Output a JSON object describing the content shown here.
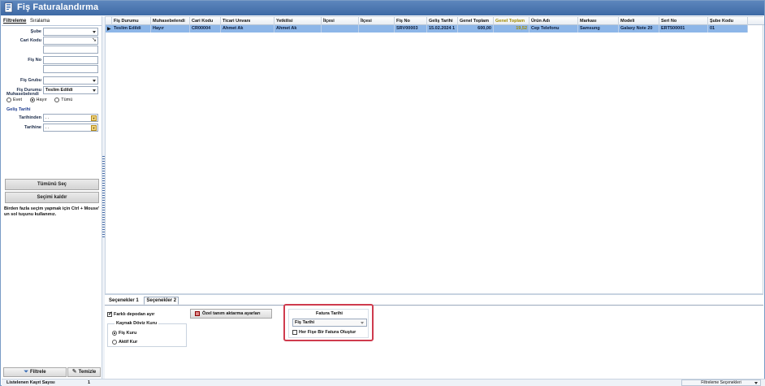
{
  "window": {
    "title": "Fiş Faturalandırma"
  },
  "left_panel": {
    "tabs": [
      {
        "label": "Filtreleme",
        "active": true
      },
      {
        "label": "Sıralama",
        "active": false
      }
    ],
    "filters": {
      "sube": {
        "label": "Şube",
        "value": ""
      },
      "cari_kodu": {
        "label": "Cari Kodu",
        "value": ""
      },
      "fis_no": {
        "label": "Fiş No",
        "value": ""
      },
      "fis_grubu": {
        "label": "Fiş Grubu",
        "value": ""
      },
      "fis_durumu": {
        "label": "Fiş Durumu",
        "value": "Teslim Edildi"
      }
    },
    "muhasebelendi": {
      "label": "Muhasebelendi",
      "options": [
        "Evet",
        "Hayır",
        "Tümü"
      ],
      "selected": "Hayır"
    },
    "gelis_tarihi": {
      "label": "Geliş Tarihi",
      "from_label": "Tarihinden",
      "from_value": " .  .",
      "to_label": "Tarihine",
      "to_value": " .  ."
    },
    "select_all_button": "Tümünü Seç",
    "clear_selection_button": "Seçimi kaldır",
    "hint": "Birden fazla seçim yapmak için Ctrl + Mouse' un sol tuşunu kullanınız.",
    "filter_button": "Filtrele",
    "clear_button": "Temizle"
  },
  "grid": {
    "columns": [
      "Fiş Durumu",
      "Muhasebelendi",
      "Cari Kodu",
      "Ticari Unvanı",
      "Yetkilisi",
      "İlçesi",
      "İlçesi",
      "Fiş No",
      "Geliş Tarihi",
      "Genel Toplam",
      "Genel Toplam",
      "Ürün Adı",
      "Markası",
      "Modeli",
      "Seri No",
      "Şube Kodu"
    ],
    "rows": [
      [
        "Teslim Edildi",
        "Hayır",
        "CR00004",
        "Ahmet Ak",
        "Ahmet Ak",
        "",
        "",
        "SRV00003",
        "15.02.2024 1",
        "600,00",
        "19,52",
        "Cep Telefonu",
        "Samsung",
        "Galaxy Note 20",
        "ERT500001",
        "01"
      ]
    ],
    "highlight_header_color": "#a08a00",
    "selected_row_color": "#8db6e8"
  },
  "options_panel": {
    "tabs": [
      {
        "label": "Seçenekler 1",
        "active": false
      },
      {
        "label": "Seçenekler 2",
        "active": true
      }
    ],
    "farkli_depodan": {
      "label": "Farklı depodan ayır",
      "checked": true
    },
    "ozel_tanim_button": "Özel tanım aktarma ayarları",
    "kaynak_doviz": {
      "label": "Kaynak Döviz Kuru",
      "options": [
        "Fiş Kuru",
        "Aktif Kur"
      ],
      "selected": "Fiş Kuru"
    },
    "fatura_tarihi": {
      "label": "Fatura Tarihi",
      "value": "Fiş Tarihi",
      "checkbox_label": "Her Fişe Bir Fatura Oluştur",
      "checked": false,
      "highlight_color": "#cf3b4e"
    }
  },
  "status_bar": {
    "label": "Listelenen Kayıt Sayısı",
    "count": "1",
    "filter_options": "Filtreleme Seçenekleri"
  }
}
